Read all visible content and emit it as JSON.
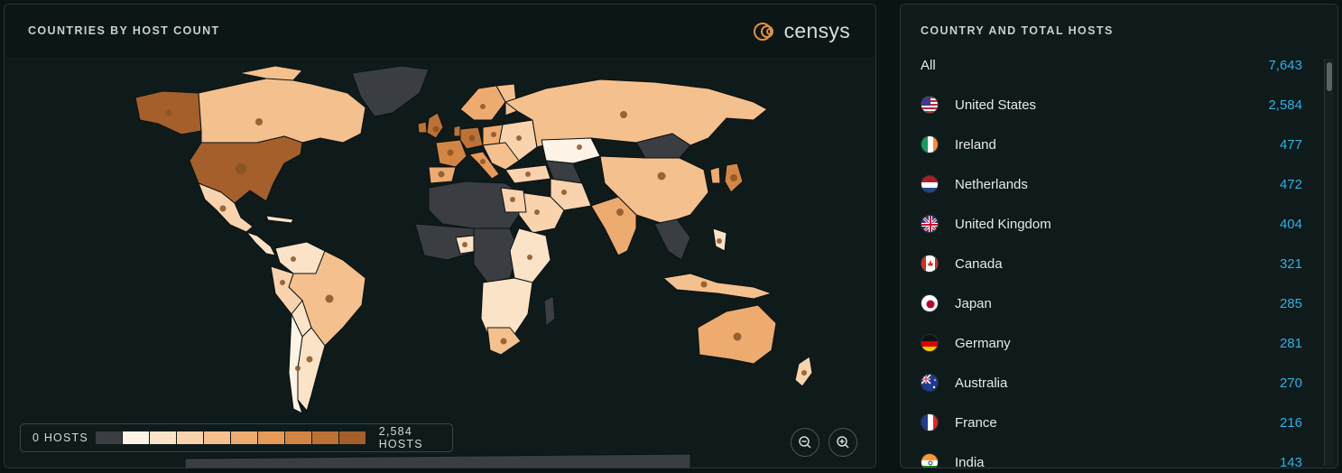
{
  "map_panel": {
    "title": "COUNTRIES BY HOST COUNT",
    "brand": "censys",
    "legend": {
      "min_label": "0 HOSTS",
      "max_label": "2,584 HOSTS",
      "colors": [
        "#3a3d42",
        "#fdf3e6",
        "#fbe3c8",
        "#f8d3ad",
        "#f4c08e",
        "#eeab70",
        "#e59a57",
        "#d38643",
        "#bd7235",
        "#a45f2b"
      ]
    },
    "zoom_out_icon": "zoom-out-icon",
    "zoom_in_icon": "zoom-in-icon"
  },
  "list_panel": {
    "title": "COUNTRY AND TOTAL HOSTS",
    "rows": [
      {
        "name": "All",
        "count": "7,643"
      },
      {
        "name": "United States",
        "count": "2,584",
        "flag": "us-flag-icon"
      },
      {
        "name": "Ireland",
        "count": "477",
        "flag": "ie-flag-icon"
      },
      {
        "name": "Netherlands",
        "count": "472",
        "flag": "nl-flag-icon"
      },
      {
        "name": "United Kingdom",
        "count": "404",
        "flag": "gb-flag-icon"
      },
      {
        "name": "Canada",
        "count": "321",
        "flag": "ca-flag-icon"
      },
      {
        "name": "Japan",
        "count": "285",
        "flag": "jp-flag-icon"
      },
      {
        "name": "Germany",
        "count": "281",
        "flag": "de-flag-icon"
      },
      {
        "name": "Australia",
        "count": "270",
        "flag": "au-flag-icon"
      },
      {
        "name": "France",
        "count": "216",
        "flag": "fr-flag-icon"
      },
      {
        "name": "India",
        "count": "143",
        "flag": "in-flag-icon"
      }
    ]
  },
  "colors": {
    "accent_count": "#2ab3e6",
    "brand_orange": "#e2913f",
    "map_no_data": "#3a3d42"
  }
}
